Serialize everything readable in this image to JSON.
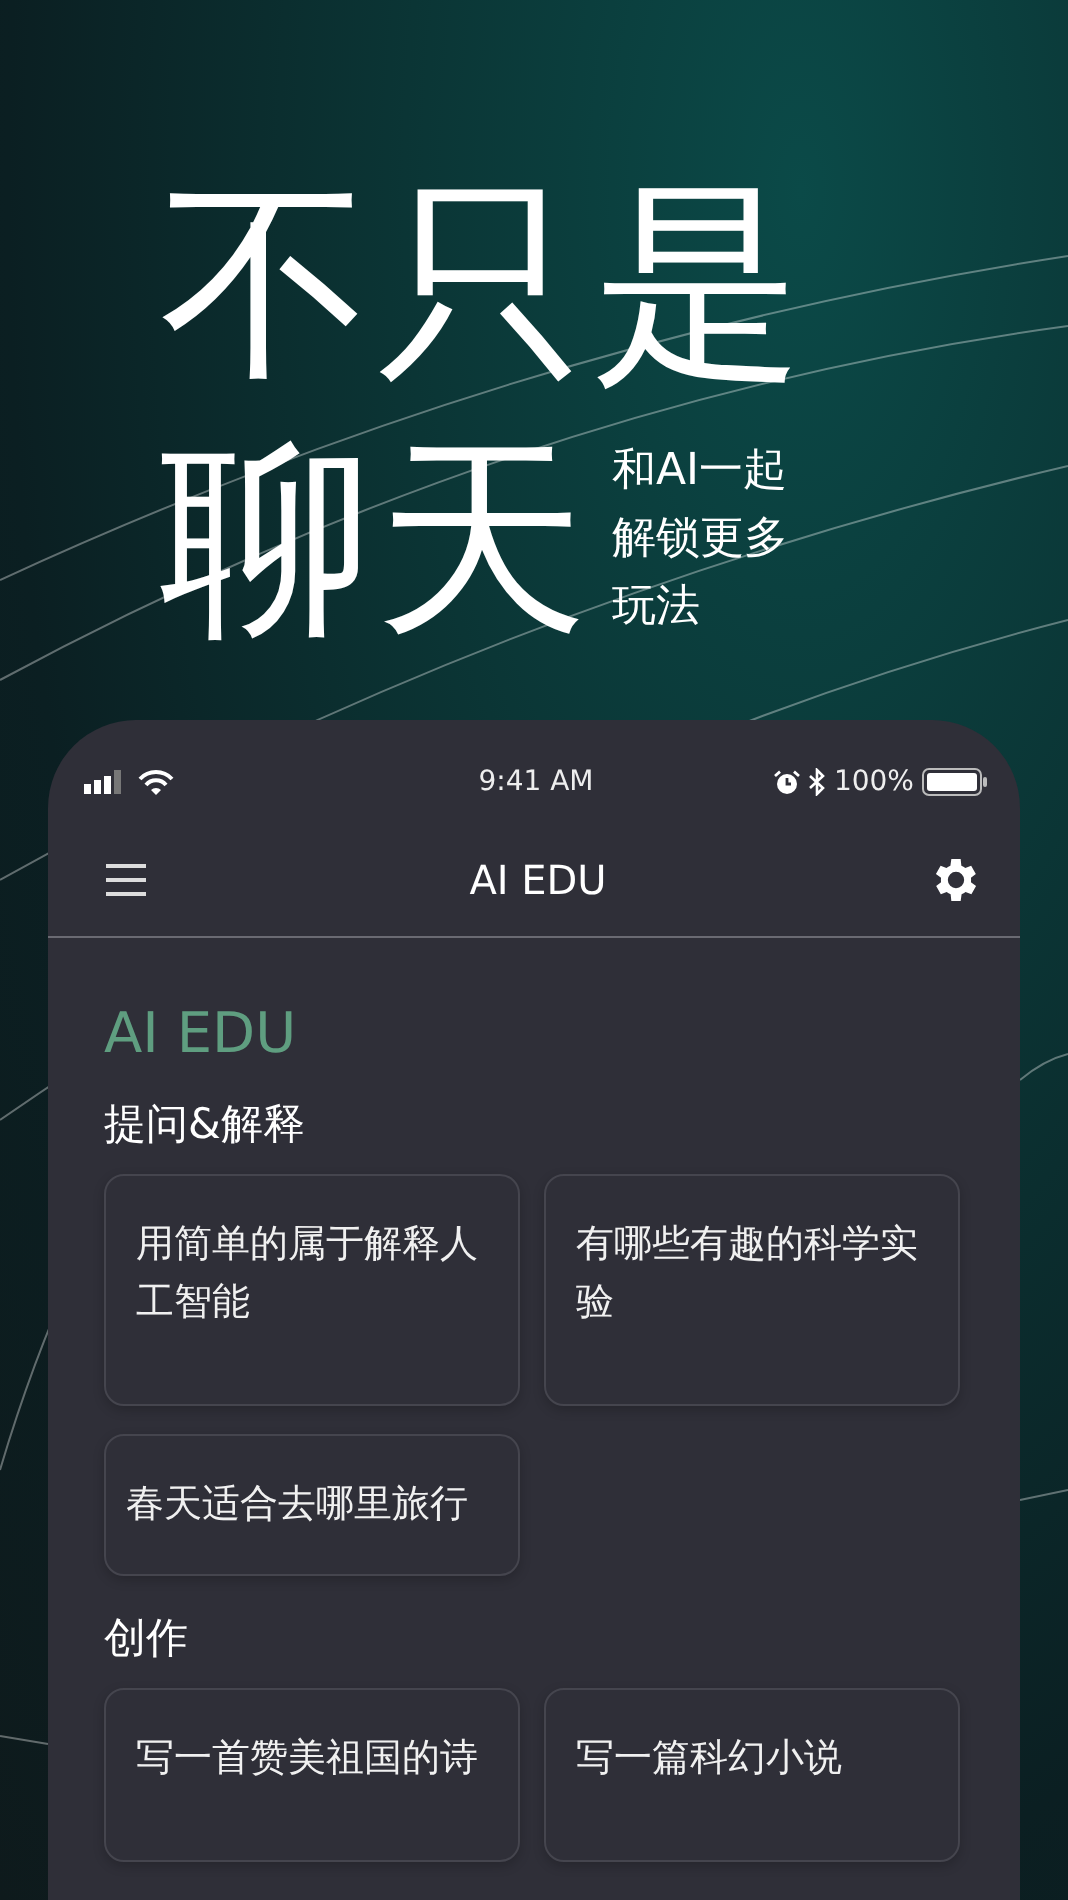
{
  "headline": {
    "lines": [
      "不只是",
      "聊天"
    ],
    "subtitle_lines": [
      "和AI一起",
      "解锁更多",
      "玩法"
    ]
  },
  "status_bar": {
    "time": "9:41 AM",
    "battery": "100%"
  },
  "nav_bar": {
    "title": "AI EDU"
  },
  "app": {
    "brand": "AI EDU",
    "sections": [
      {
        "title": "提问&解释",
        "prompts": [
          "用简单的属于解释人工智能",
          "有哪些有趣的科学实验",
          "春天适合去哪里旅行"
        ]
      },
      {
        "title": "创作",
        "prompts": [
          "写一首赞美祖国的诗",
          "写一篇科幻小说"
        ]
      }
    ]
  }
}
